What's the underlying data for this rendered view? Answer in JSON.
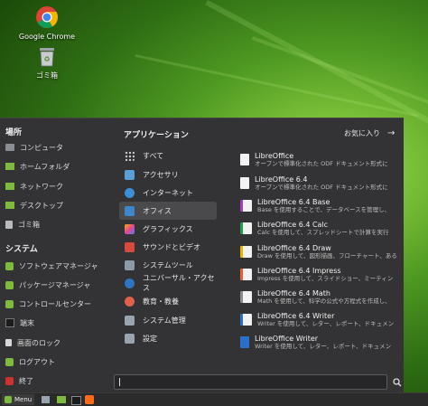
{
  "desktop": {
    "icons": [
      {
        "label": "Google Chrome",
        "icon": "chrome-icon"
      },
      {
        "label": "ゴミ箱",
        "icon": "trash-icon"
      }
    ]
  },
  "menu": {
    "places_title": "場所",
    "places": [
      "コンピュータ",
      "ホームフォルダ",
      "ネットワーク",
      "デスクトップ",
      "ゴミ箱"
    ],
    "system_title": "システム",
    "system": [
      "ソフトウェアマネージャ",
      "パッケージマネージャ",
      "コントロールセンター",
      "端末",
      "画面のロック",
      "ログアウト",
      "終了"
    ],
    "apps_title": "アプリケーション",
    "favorites_label": "お気に入り",
    "categories": [
      "すべて",
      "アクセサリ",
      "インターネット",
      "オフィス",
      "グラフィックス",
      "サウンドとビデオ",
      "システムツール",
      "ユニバーサル・アクセス",
      "教育・教養",
      "システム管理",
      "設定"
    ],
    "selected_category": "オフィス",
    "apps": [
      {
        "name": "LibreOffice",
        "desc": "オープンで標準化された ODF ドキュメント形式に"
      },
      {
        "name": "LibreOffice 6.4",
        "desc": "オープンで標準化された ODF ドキュメント形式に"
      },
      {
        "name": "LibreOffice 6.4 Base",
        "desc": "Base を使用することで、データベースを管理し、"
      },
      {
        "name": "LibreOffice 6.4 Calc",
        "desc": "Calc を使用して、スプレッドシートで計算を実行"
      },
      {
        "name": "LibreOffice 6.4 Draw",
        "desc": "Draw を使用して、図形描画、フローチャート、ある"
      },
      {
        "name": "LibreOffice 6.4 Impress",
        "desc": "Impress を使用して、スライドショー、ミーティン"
      },
      {
        "name": "LibreOffice 6.4 Math",
        "desc": "Math を使用して、科学の公式や方程式を作成し、"
      },
      {
        "name": "LibreOffice 6.4 Writer",
        "desc": "Writer を使用して、レター、レポート、ドキュメン"
      },
      {
        "name": "LibreOffice Writer",
        "desc": "Writer を使用して、レター、レポート、ドキュメン"
      }
    ],
    "search_value": ""
  },
  "taskbar": {
    "menu_label": "Menu"
  }
}
